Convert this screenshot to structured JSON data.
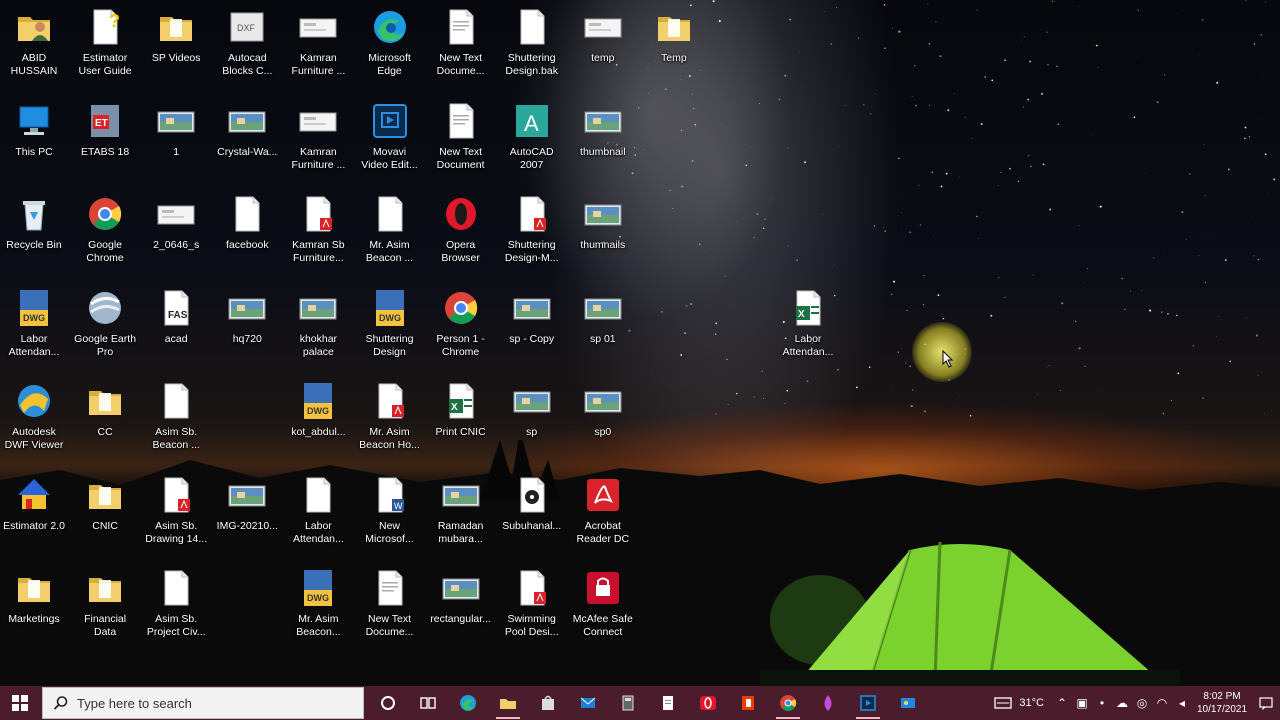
{
  "desktop": {
    "icons": [
      {
        "label": "ABID\nHUSSAIN",
        "icon": "user-folder-icon",
        "col": 0,
        "row": 0
      },
      {
        "label": "Estimator\nUser Guide",
        "icon": "help-document-icon",
        "col": 1,
        "row": 0
      },
      {
        "label": "SP Videos",
        "icon": "folder-icon",
        "col": 2,
        "row": 0
      },
      {
        "label": "Autocad\nBlocks C...",
        "icon": "dxf-file-icon",
        "col": 3,
        "row": 0
      },
      {
        "label": "Kamran\nFurniture ...",
        "icon": "image-thumb-icon",
        "col": 4,
        "row": 0
      },
      {
        "label": "Microsoft\nEdge",
        "icon": "edge-icon",
        "col": 5,
        "row": 0
      },
      {
        "label": "New Text\nDocume...",
        "icon": "text-document-icon",
        "col": 6,
        "row": 0
      },
      {
        "label": "Shuttering\nDesign.bak",
        "icon": "blank-file-icon",
        "col": 7,
        "row": 0
      },
      {
        "label": "temp",
        "icon": "image-thumb-icon",
        "col": 8,
        "row": 0
      },
      {
        "label": "Temp",
        "icon": "folder-icon",
        "col": 9,
        "row": 0
      },
      {
        "label": "This PC",
        "icon": "this-pc-icon",
        "col": 0,
        "row": 1
      },
      {
        "label": "ETABS 18",
        "icon": "etabs-icon",
        "col": 1,
        "row": 1
      },
      {
        "label": "1",
        "icon": "photo-thumb-icon",
        "col": 2,
        "row": 1
      },
      {
        "label": "Crystal-Wa...",
        "icon": "photo-thumb-icon",
        "col": 3,
        "row": 1
      },
      {
        "label": "Kamran\nFurniture ...",
        "icon": "image-thumb-icon",
        "col": 4,
        "row": 1
      },
      {
        "label": "Movavi\nVideo Edit...",
        "icon": "movavi-icon",
        "col": 5,
        "row": 1
      },
      {
        "label": "New Text\nDocument",
        "icon": "text-document-icon",
        "col": 6,
        "row": 1
      },
      {
        "label": "AutoCAD\n2007",
        "icon": "autocad-icon",
        "col": 7,
        "row": 1
      },
      {
        "label": "thumbnail",
        "icon": "photo-thumb-icon",
        "col": 8,
        "row": 1
      },
      {
        "label": "Recycle Bin",
        "icon": "recycle-bin-icon",
        "col": 0,
        "row": 2
      },
      {
        "label": "Google\nChrome",
        "icon": "chrome-icon",
        "col": 1,
        "row": 2
      },
      {
        "label": "2_0646_s",
        "icon": "image-thumb-icon",
        "col": 2,
        "row": 2
      },
      {
        "label": "facebook",
        "icon": "blank-file-icon",
        "col": 3,
        "row": 2
      },
      {
        "label": "Kamran Sb\nFurniture...",
        "icon": "pdf-file-icon",
        "col": 4,
        "row": 2
      },
      {
        "label": "Mr. Asim\nBeacon ...",
        "icon": "blank-file-icon",
        "col": 5,
        "row": 2
      },
      {
        "label": "Opera\nBrowser",
        "icon": "opera-icon",
        "col": 6,
        "row": 2
      },
      {
        "label": "Shuttering\nDesign-M...",
        "icon": "pdf-file-icon",
        "col": 7,
        "row": 2
      },
      {
        "label": "thumnails",
        "icon": "photo-thumb-icon",
        "col": 8,
        "row": 2
      },
      {
        "label": "Labor\nAttendan...",
        "icon": "dwg-file-icon",
        "col": 0,
        "row": 3
      },
      {
        "label": "Google Earth\nPro",
        "icon": "google-earth-icon",
        "col": 1,
        "row": 3
      },
      {
        "label": "acad",
        "icon": "fas-file-icon",
        "col": 2,
        "row": 3
      },
      {
        "label": "hq720",
        "icon": "photo-thumb-icon",
        "col": 3,
        "row": 3
      },
      {
        "label": "khokhar\npalace",
        "icon": "photo-thumb-icon",
        "col": 4,
        "row": 3
      },
      {
        "label": "Shuttering\nDesign",
        "icon": "dwg-file-icon",
        "col": 5,
        "row": 3
      },
      {
        "label": "Person 1 -\nChrome",
        "icon": "chrome-icon",
        "col": 6,
        "row": 3
      },
      {
        "label": "sp - Copy",
        "icon": "photo-thumb-icon",
        "col": 7,
        "row": 3
      },
      {
        "label": "sp 01",
        "icon": "photo-thumb-icon",
        "col": 8,
        "row": 3
      },
      {
        "label": "Autodesk\nDWF Viewer",
        "icon": "dwf-viewer-icon",
        "col": 0,
        "row": 4
      },
      {
        "label": "CC",
        "icon": "folder-icon",
        "col": 1,
        "row": 4
      },
      {
        "label": "Asim Sb.\nBeacon ...",
        "icon": "blank-file-icon",
        "col": 2,
        "row": 4
      },
      {
        "label": "kot_abdul...",
        "icon": "dwg-file-icon",
        "col": 4,
        "row": 4
      },
      {
        "label": "Mr. Asim\nBeacon Ho...",
        "icon": "pdf-file-icon",
        "col": 5,
        "row": 4
      },
      {
        "label": "Print CNIC",
        "icon": "excel-file-icon",
        "col": 6,
        "row": 4
      },
      {
        "label": "sp",
        "icon": "photo-thumb-icon",
        "col": 7,
        "row": 4
      },
      {
        "label": "sp0",
        "icon": "photo-thumb-icon",
        "col": 8,
        "row": 4
      },
      {
        "label": "Estimator 2.0",
        "icon": "estimator-icon",
        "col": 0,
        "row": 5
      },
      {
        "label": "CNIC",
        "icon": "folder-icon",
        "col": 1,
        "row": 5
      },
      {
        "label": "Asim Sb.\nDrawing 14...",
        "icon": "pdf-file-icon",
        "col": 2,
        "row": 5
      },
      {
        "label": "IMG-20210...",
        "icon": "photo-thumb-icon",
        "col": 3,
        "row": 5
      },
      {
        "label": "Labor\nAttendan...",
        "icon": "blank-file-icon",
        "col": 4,
        "row": 5
      },
      {
        "label": "New\nMicrosof...",
        "icon": "word-file-icon",
        "col": 5,
        "row": 5
      },
      {
        "label": "Ramadan\nmubara...",
        "icon": "photo-thumb-icon",
        "col": 6,
        "row": 5
      },
      {
        "label": "Subuhanal...",
        "icon": "audio-file-icon",
        "col": 7,
        "row": 5
      },
      {
        "label": "Acrobat\nReader DC",
        "icon": "acrobat-icon",
        "col": 8,
        "row": 5
      },
      {
        "label": "Marketings",
        "icon": "folder-icon",
        "col": 0,
        "row": 6
      },
      {
        "label": "Financial\nData",
        "icon": "folder-icon",
        "col": 1,
        "row": 6
      },
      {
        "label": "Asim Sb.\nProject Civ...",
        "icon": "blank-file-icon",
        "col": 2,
        "row": 6
      },
      {
        "label": "Mr. Asim\nBeacon...",
        "icon": "dwg-file-icon",
        "col": 4,
        "row": 6
      },
      {
        "label": "New Text\nDocume...",
        "icon": "text-document-icon",
        "col": 5,
        "row": 6
      },
      {
        "label": "rectangular...",
        "icon": "photo-thumb-icon",
        "col": 6,
        "row": 6
      },
      {
        "label": "Swimming\nPool Desi...",
        "icon": "pdf-file-icon",
        "col": 7,
        "row": 6
      },
      {
        "label": "McAfee Safe\nConnect",
        "icon": "mcafee-icon",
        "col": 8,
        "row": 6
      }
    ],
    "floating_icon": {
      "label": "Labor\nAttendan...",
      "icon": "excel-file-icon"
    }
  },
  "taskbar": {
    "search_placeholder": "Type here to search",
    "pinned": [
      "cortana-icon",
      "task-view-icon",
      "edge-icon",
      "file-explorer-icon",
      "store-icon",
      "mail-icon",
      "calculator-icon",
      "notepad-icon",
      "opera-icon",
      "office-icon",
      "chrome-icon",
      "paint-icon",
      "movavi-icon",
      "photos-icon"
    ],
    "tray": {
      "temperature": "31°C",
      "time": "8:02 PM",
      "date": "10/17/2021"
    }
  },
  "colors": {
    "taskbar": "#4a1c2c",
    "folder": "#f2cf6a",
    "pdf": "#d8232a",
    "excel": "#1e7145",
    "dwg": "#f3c340",
    "tent": "#7bd12e"
  }
}
